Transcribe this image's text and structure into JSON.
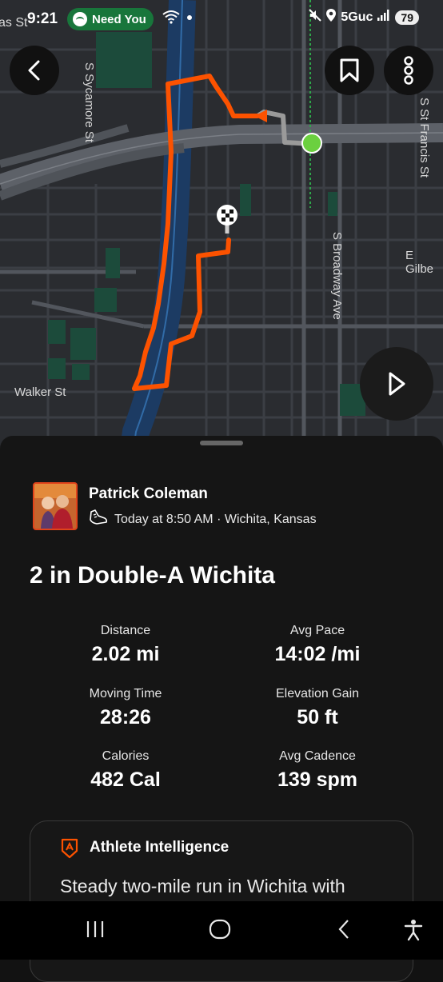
{
  "status_bar": {
    "time": "9:21",
    "media_text": "Need You",
    "network": "5Guc",
    "battery": "79",
    "left_fragment": "as St"
  },
  "map": {
    "labels": {
      "sycamore": "S Sycamore St",
      "st_francis": "S St Francis St",
      "broadway": "S Broadway Ave",
      "gilbert": "E Gilbe",
      "walker": "Walker St"
    },
    "route_color": "#fc5200"
  },
  "activity": {
    "athlete_name": "Patrick Coleman",
    "meta": "Today at 8:50 AM · Wichita, Kansas",
    "title": "2 in Double-A Wichita",
    "stats": [
      {
        "label": "Distance",
        "value": "2.02 mi"
      },
      {
        "label": "Avg Pace",
        "value": "14:02 /mi"
      },
      {
        "label": "Moving Time",
        "value": "28:26"
      },
      {
        "label": "Elevation Gain",
        "value": "50 ft"
      },
      {
        "label": "Calories",
        "value": "482 Cal"
      },
      {
        "label": "Avg Cadence",
        "value": "139 spm"
      }
    ],
    "ai_card": {
      "title": "Athlete Intelligence",
      "text": "Steady two-mile run in Wichita with"
    }
  }
}
